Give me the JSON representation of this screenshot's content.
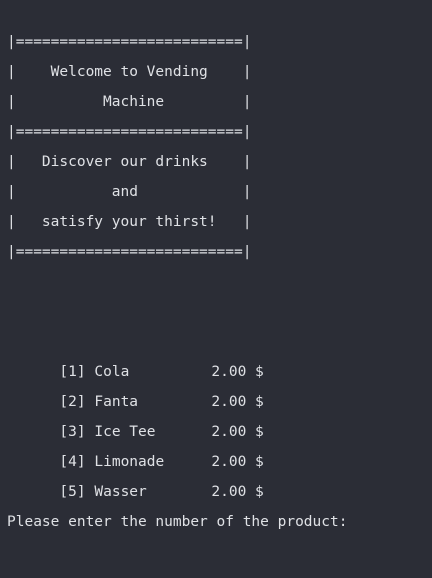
{
  "banner": {
    "lines": [
      "|==========================|",
      "|    Welcome to Vending    |",
      "|          Machine         |",
      "|==========================|",
      "|   Discover our drinks    |",
      "|           and            |",
      "|   satisfy your thirst!   |",
      "|==========================|"
    ]
  },
  "menu": {
    "items": [
      {
        "number": "[1]",
        "name": "Cola",
        "price": "2.00 $"
      },
      {
        "number": "[2]",
        "name": "Fanta",
        "price": "2.00 $"
      },
      {
        "number": "[3]",
        "name": "Ice Tee",
        "price": "2.00 $"
      },
      {
        "number": "[4]",
        "name": "Limonade",
        "price": "2.00 $"
      },
      {
        "number": "[5]",
        "name": "Wasser",
        "price": "2.00 $"
      }
    ]
  },
  "prompt": {
    "text": "Please enter the number of the product:"
  },
  "colors": {
    "background": "#2b2d36",
    "text": "#dfe1e5"
  }
}
